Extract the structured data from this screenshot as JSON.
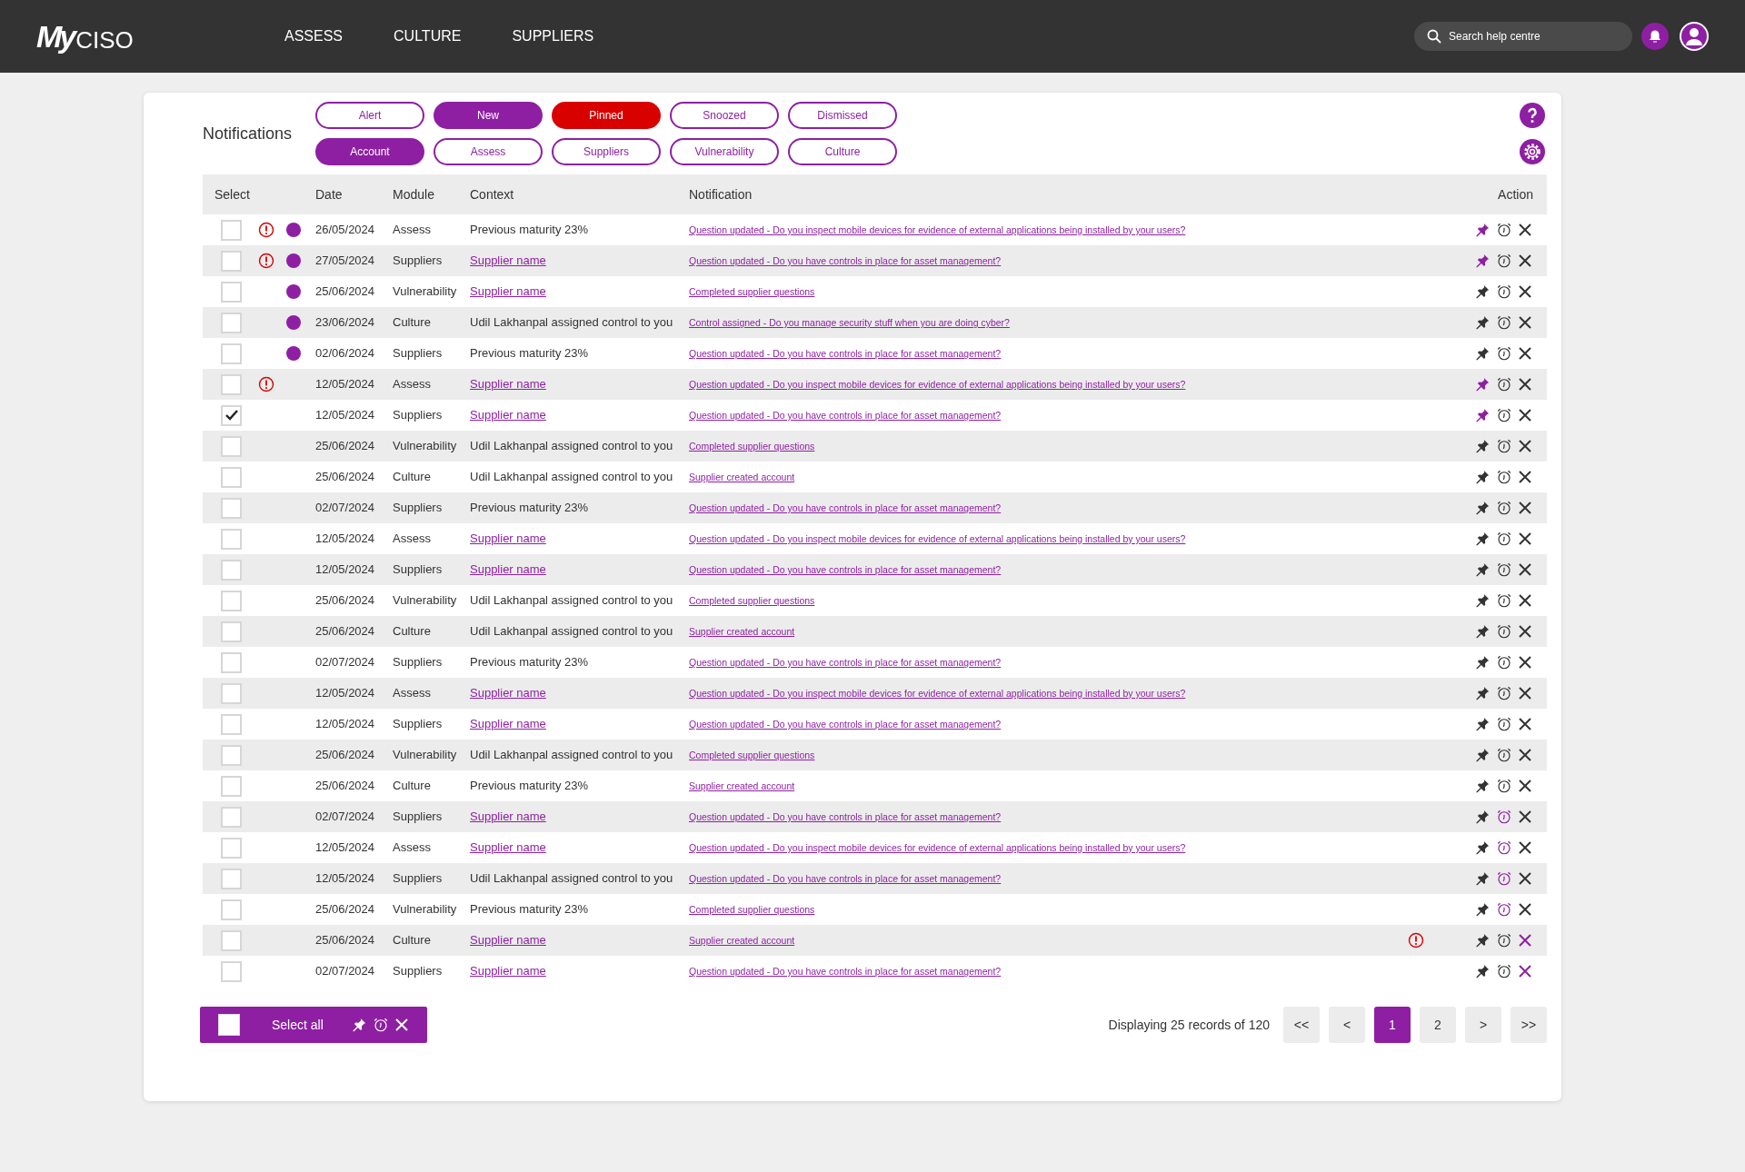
{
  "header": {
    "logo_mark": "My",
    "logo_text": "CISO",
    "nav": [
      "ASSESS",
      "CULTURE",
      "SUPPLIERS"
    ],
    "search": {
      "placeholder": "Search help centre"
    }
  },
  "panel": {
    "title": "Notifications",
    "filters": [
      [
        {
          "label": "Alert",
          "selected": false,
          "color": "#8e1fa3"
        },
        {
          "label": "New",
          "selected": true,
          "color": "#8e1fa3"
        },
        {
          "label": "Pinned",
          "selected": true,
          "color": "#d90000"
        },
        {
          "label": "Snoozed",
          "selected": false,
          "color": "#8e1fa3"
        },
        {
          "label": "Dismissed",
          "selected": false,
          "color": "#8e1fa3"
        }
      ],
      [
        {
          "label": "Account",
          "selected": true,
          "color": "#8e1fa3"
        },
        {
          "label": "Assess",
          "selected": false,
          "color": "#8e1fa3"
        },
        {
          "label": "Suppliers",
          "selected": false,
          "color": "#8e1fa3"
        },
        {
          "label": "Vulnerability",
          "selected": false,
          "color": "#8e1fa3"
        },
        {
          "label": "Culture",
          "selected": false,
          "color": "#8e1fa3"
        }
      ]
    ],
    "table": {
      "columns": [
        "Select",
        "Date",
        "Module",
        "Context",
        "Notification",
        "Action"
      ],
      "rows": [
        {
          "checked": false,
          "alert": true,
          "new": true,
          "date": "26/05/2024",
          "module": "Assess",
          "context": {
            "kind": "text",
            "text": "Previous maturity 23%"
          },
          "notification": "Question updated - Do you inspect mobile devices for evidence of external applications being installed by your users?",
          "warning": false,
          "pinned": true,
          "snoozed": false,
          "dismissed": false
        },
        {
          "checked": false,
          "alert": true,
          "new": true,
          "date": "27/05/2024",
          "module": "Suppliers",
          "context": {
            "kind": "link",
            "text": "Supplier name"
          },
          "notification": "Question updated - Do you have controls in place for asset management?",
          "warning": false,
          "pinned": true,
          "snoozed": false,
          "dismissed": false
        },
        {
          "checked": false,
          "alert": false,
          "new": true,
          "date": "25/06/2024",
          "module": "Vulnerability",
          "context": {
            "kind": "link",
            "text": "Supplier name"
          },
          "notification": "Completed supplier questions",
          "warning": false,
          "pinned": false,
          "snoozed": false,
          "dismissed": false
        },
        {
          "checked": false,
          "alert": false,
          "new": true,
          "date": "23/06/2024",
          "module": "Culture",
          "context": {
            "kind": "text",
            "text": "Udil Lakhanpal assigned control to you"
          },
          "notification": "Control assigned - Do you manage security stuff when you are doing cyber?",
          "warning": false,
          "pinned": false,
          "snoozed": false,
          "dismissed": false
        },
        {
          "checked": false,
          "alert": false,
          "new": true,
          "date": "02/06/2024",
          "module": "Suppliers",
          "context": {
            "kind": "text",
            "text": "Previous maturity 23%"
          },
          "notification": "Question updated - Do you have controls in place for asset management?",
          "warning": false,
          "pinned": false,
          "snoozed": false,
          "dismissed": false
        },
        {
          "checked": false,
          "alert": true,
          "new": false,
          "date": "12/05/2024",
          "module": "Assess",
          "context": {
            "kind": "link",
            "text": "Supplier name"
          },
          "notification": "Question updated - Do you inspect mobile devices for evidence of external applications being installed by your users?",
          "warning": false,
          "pinned": true,
          "snoozed": false,
          "dismissed": false
        },
        {
          "checked": true,
          "alert": false,
          "new": false,
          "date": "12/05/2024",
          "module": "Suppliers",
          "context": {
            "kind": "link",
            "text": "Supplier name"
          },
          "notification": "Question updated - Do you have controls in place for asset management?",
          "warning": false,
          "pinned": true,
          "snoozed": false,
          "dismissed": false
        },
        {
          "checked": false,
          "alert": false,
          "new": false,
          "date": "25/06/2024",
          "module": "Vulnerability",
          "context": {
            "kind": "text",
            "text": "Udil Lakhanpal assigned control to you"
          },
          "notification": "Completed supplier questions",
          "warning": false,
          "pinned": false,
          "snoozed": false,
          "dismissed": false
        },
        {
          "checked": false,
          "alert": false,
          "new": false,
          "date": "25/06/2024",
          "module": "Culture",
          "context": {
            "kind": "text",
            "text": "Udil Lakhanpal assigned control to you"
          },
          "notification": "Supplier created account",
          "warning": false,
          "pinned": false,
          "snoozed": false,
          "dismissed": false
        },
        {
          "checked": false,
          "alert": false,
          "new": false,
          "date": "02/07/2024",
          "module": "Suppliers",
          "context": {
            "kind": "text",
            "text": "Previous maturity 23%"
          },
          "notification": "Question updated - Do you have controls in place for asset management?",
          "warning": false,
          "pinned": false,
          "snoozed": false,
          "dismissed": false
        },
        {
          "checked": false,
          "alert": false,
          "new": false,
          "date": "12/05/2024",
          "module": "Assess",
          "context": {
            "kind": "link",
            "text": "Supplier name"
          },
          "notification": "Question updated - Do you inspect mobile devices for evidence of external applications being installed by your users?",
          "warning": false,
          "pinned": false,
          "snoozed": false,
          "dismissed": false
        },
        {
          "checked": false,
          "alert": false,
          "new": false,
          "date": "12/05/2024",
          "module": "Suppliers",
          "context": {
            "kind": "link",
            "text": "Supplier name"
          },
          "notification": "Question updated - Do you have controls in place for asset management?",
          "warning": false,
          "pinned": false,
          "snoozed": false,
          "dismissed": false
        },
        {
          "checked": false,
          "alert": false,
          "new": false,
          "date": "25/06/2024",
          "module": "Vulnerability",
          "context": {
            "kind": "text",
            "text": "Udil Lakhanpal assigned control to you"
          },
          "notification": "Completed supplier questions",
          "warning": false,
          "pinned": false,
          "snoozed": false,
          "dismissed": false
        },
        {
          "checked": false,
          "alert": false,
          "new": false,
          "date": "25/06/2024",
          "module": "Culture",
          "context": {
            "kind": "text",
            "text": "Udil Lakhanpal assigned control to you"
          },
          "notification": "Supplier created account",
          "warning": false,
          "pinned": false,
          "snoozed": false,
          "dismissed": false
        },
        {
          "checked": false,
          "alert": false,
          "new": false,
          "date": "02/07/2024",
          "module": "Suppliers",
          "context": {
            "kind": "text",
            "text": "Previous maturity 23%"
          },
          "notification": "Question updated - Do you have controls in place for asset management?",
          "warning": false,
          "pinned": false,
          "snoozed": false,
          "dismissed": false
        },
        {
          "checked": false,
          "alert": false,
          "new": false,
          "date": "12/05/2024",
          "module": "Assess",
          "context": {
            "kind": "link",
            "text": "Supplier name"
          },
          "notification": "Question updated - Do you inspect mobile devices for evidence of external applications being installed by your users?",
          "warning": false,
          "pinned": false,
          "snoozed": false,
          "dismissed": false
        },
        {
          "checked": false,
          "alert": false,
          "new": false,
          "date": "12/05/2024",
          "module": "Suppliers",
          "context": {
            "kind": "link",
            "text": "Supplier name"
          },
          "notification": "Question updated - Do you have controls in place for asset management?",
          "warning": false,
          "pinned": false,
          "snoozed": false,
          "dismissed": false
        },
        {
          "checked": false,
          "alert": false,
          "new": false,
          "date": "25/06/2024",
          "module": "Vulnerability",
          "context": {
            "kind": "text",
            "text": "Udil Lakhanpal assigned control to you"
          },
          "notification": "Completed supplier questions",
          "warning": false,
          "pinned": false,
          "snoozed": false,
          "dismissed": false
        },
        {
          "checked": false,
          "alert": false,
          "new": false,
          "date": "25/06/2024",
          "module": "Culture",
          "context": {
            "kind": "text",
            "text": "Previous maturity 23%"
          },
          "notification": "Supplier created account",
          "warning": false,
          "pinned": false,
          "snoozed": false,
          "dismissed": false
        },
        {
          "checked": false,
          "alert": false,
          "new": false,
          "date": "02/07/2024",
          "module": "Suppliers",
          "context": {
            "kind": "link",
            "text": "Supplier name"
          },
          "notification": "Question updated - Do you have controls in place for asset management?",
          "warning": false,
          "pinned": false,
          "snoozed": true,
          "dismissed": false
        },
        {
          "checked": false,
          "alert": false,
          "new": false,
          "date": "12/05/2024",
          "module": "Assess",
          "context": {
            "kind": "link",
            "text": "Supplier name"
          },
          "notification": "Question updated - Do you inspect mobile devices for evidence of external applications being installed by your users?",
          "warning": false,
          "pinned": false,
          "snoozed": true,
          "dismissed": false
        },
        {
          "checked": false,
          "alert": false,
          "new": false,
          "date": "12/05/2024",
          "module": "Suppliers",
          "context": {
            "kind": "text",
            "text": "Udil Lakhanpal assigned control to you"
          },
          "notification": "Question updated - Do you have controls in place for asset management?",
          "warning": false,
          "pinned": false,
          "snoozed": true,
          "dismissed": false
        },
        {
          "checked": false,
          "alert": false,
          "new": false,
          "date": "25/06/2024",
          "module": "Vulnerability",
          "context": {
            "kind": "text",
            "text": "Previous maturity 23%"
          },
          "notification": "Completed supplier questions",
          "warning": false,
          "pinned": false,
          "snoozed": true,
          "dismissed": false
        },
        {
          "checked": false,
          "alert": false,
          "new": false,
          "date": "25/06/2024",
          "module": "Culture",
          "context": {
            "kind": "link",
            "text": "Supplier name"
          },
          "notification": "Supplier created account",
          "warning": true,
          "pinned": false,
          "snoozed": false,
          "dismissed": true
        },
        {
          "checked": false,
          "alert": false,
          "new": false,
          "date": "02/07/2024",
          "module": "Suppliers",
          "context": {
            "kind": "link",
            "text": "Supplier name"
          },
          "notification": "Question updated - Do you have controls in place for asset management?",
          "warning": false,
          "pinned": false,
          "snoozed": false,
          "dismissed": true
        }
      ]
    },
    "footer": {
      "select_all": {
        "label": "Select all",
        "checked": false
      },
      "summary": "Displaying 25 records of 120",
      "pages": [
        {
          "label": "<<",
          "selected": false
        },
        {
          "label": "<",
          "selected": false
        },
        {
          "label": "1",
          "selected": true
        },
        {
          "label": "2",
          "selected": false
        },
        {
          "label": ">",
          "selected": false
        },
        {
          "label": ">>",
          "selected": false
        }
      ]
    }
  }
}
